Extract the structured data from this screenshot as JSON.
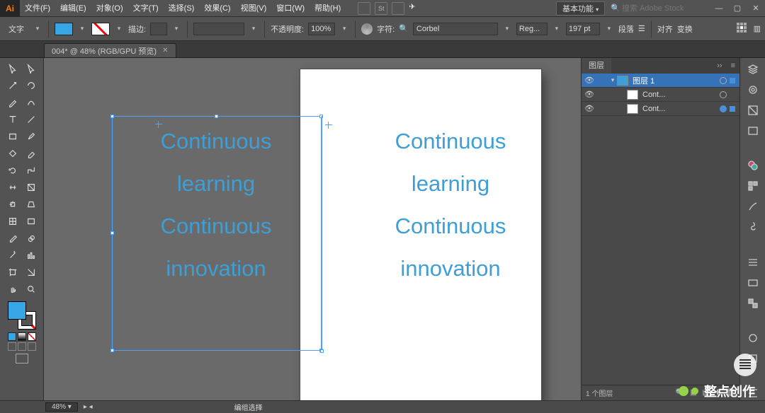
{
  "menu": {
    "items": [
      "文件(F)",
      "编辑(E)",
      "对象(O)",
      "文字(T)",
      "选择(S)",
      "效果(C)",
      "视图(V)",
      "窗口(W)",
      "帮助(H)"
    ],
    "workspace": "基本功能",
    "search_ph": "搜索 Adobe Stock"
  },
  "ctrl": {
    "tool": "文字",
    "stroke_lbl": "描边:",
    "opacity_lbl": "不透明度:",
    "opacity": "100%",
    "char_lbl": "字符:",
    "font": "Corbel",
    "weight": "Reg...",
    "size": "197 pt",
    "para": "段落",
    "align": "对齐",
    "transform": "变换"
  },
  "tab": {
    "title": "004* @ 48% (RGB/GPU 预览)"
  },
  "canvas": {
    "line1": "Continuous",
    "line2": "learning",
    "line3": "Continuous",
    "line4": "innovation"
  },
  "panel": {
    "title": "图层",
    "layer1": "图层 1",
    "item": "Cont...",
    "footer": "1 个图层"
  },
  "status": {
    "zoom": "48%",
    "mode": "编组选择"
  },
  "wm": "整点创作",
  "tool_names": [
    "selection",
    "direct-selection",
    "magic-wand",
    "lasso",
    "pen",
    "curvature",
    "type",
    "line",
    "rectangle",
    "paintbrush",
    "shaper",
    "eraser",
    "rotate",
    "scale",
    "width",
    "free-transform",
    "shape-builder",
    "perspective",
    "mesh",
    "gradient",
    "eyedropper",
    "blend",
    "symbol-sprayer",
    "column-graph",
    "artboard",
    "slice",
    "hand",
    "zoom"
  ]
}
